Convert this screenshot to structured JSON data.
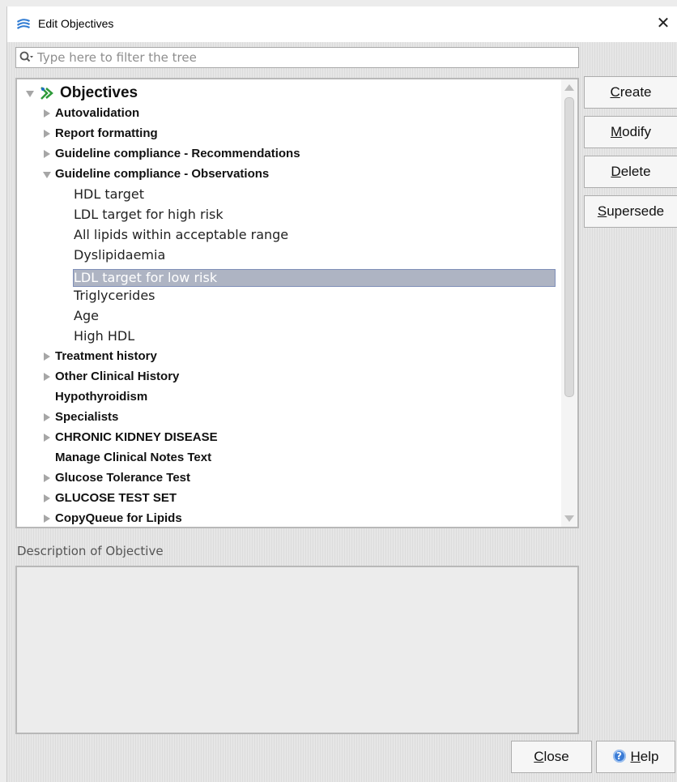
{
  "window": {
    "title": "Edit Objectives",
    "close_glyph": "✕",
    "app_icon": "layers-logo-icon"
  },
  "filter": {
    "placeholder": "Type here to filter the tree",
    "value": ""
  },
  "tree": {
    "root": "Objectives",
    "items": [
      {
        "label": "Autovalidation",
        "expander": "collapsed"
      },
      {
        "label": "Report formatting",
        "expander": "collapsed"
      },
      {
        "label": "Guideline compliance - Recommendations",
        "expander": "collapsed"
      },
      {
        "label": "Guideline compliance - Observations",
        "expander": "expanded"
      },
      {
        "label": "HDL target",
        "expander": "none"
      },
      {
        "label": "LDL target for high risk",
        "expander": "none"
      },
      {
        "label": "All lipids within acceptable range",
        "expander": "none"
      },
      {
        "label": "Dyslipidaemia",
        "expander": "none"
      },
      {
        "label": "LDL target for low risk",
        "expander": "none",
        "selected": true
      },
      {
        "label": "Triglycerides",
        "expander": "none"
      },
      {
        "label": "Age",
        "expander": "none"
      },
      {
        "label": "High HDL",
        "expander": "none"
      },
      {
        "label": "Treatment history",
        "expander": "collapsed"
      },
      {
        "label": "Other Clinical History",
        "expander": "collapsed"
      },
      {
        "label": "Hypothyroidism",
        "expander": "none"
      },
      {
        "label": "Specialists",
        "expander": "collapsed"
      },
      {
        "label": "CHRONIC KIDNEY DISEASE",
        "expander": "collapsed"
      },
      {
        "label": "Manage Clinical Notes Text",
        "expander": "none"
      },
      {
        "label": "Glucose Tolerance Test",
        "expander": "collapsed"
      },
      {
        "label": "GLUCOSE TEST SET",
        "expander": "collapsed"
      },
      {
        "label": "CopyQueue for Lipids",
        "expander": "collapsed"
      }
    ]
  },
  "description": {
    "label": "Description of Objective",
    "value": ""
  },
  "buttons": {
    "create": {
      "pre": "",
      "mnemonic": "C",
      "post": "reate"
    },
    "modify": {
      "pre": "",
      "mnemonic": "M",
      "post": "odify"
    },
    "delete": {
      "pre": "",
      "mnemonic": "D",
      "post": "elete"
    },
    "supersede": {
      "pre": "",
      "mnemonic": "S",
      "post": "upersede"
    },
    "close": {
      "pre": "",
      "mnemonic": "C",
      "post": "lose"
    },
    "help": {
      "pre": "",
      "mnemonic": "H",
      "post": "elp",
      "icon": "help-icon"
    }
  },
  "colors": {
    "selection": "#aeb4c3",
    "selection_border": "#7f8fb8",
    "app_icon_blue": "#2f7bd3",
    "objectives_icon_green": "#2e9b3a"
  }
}
